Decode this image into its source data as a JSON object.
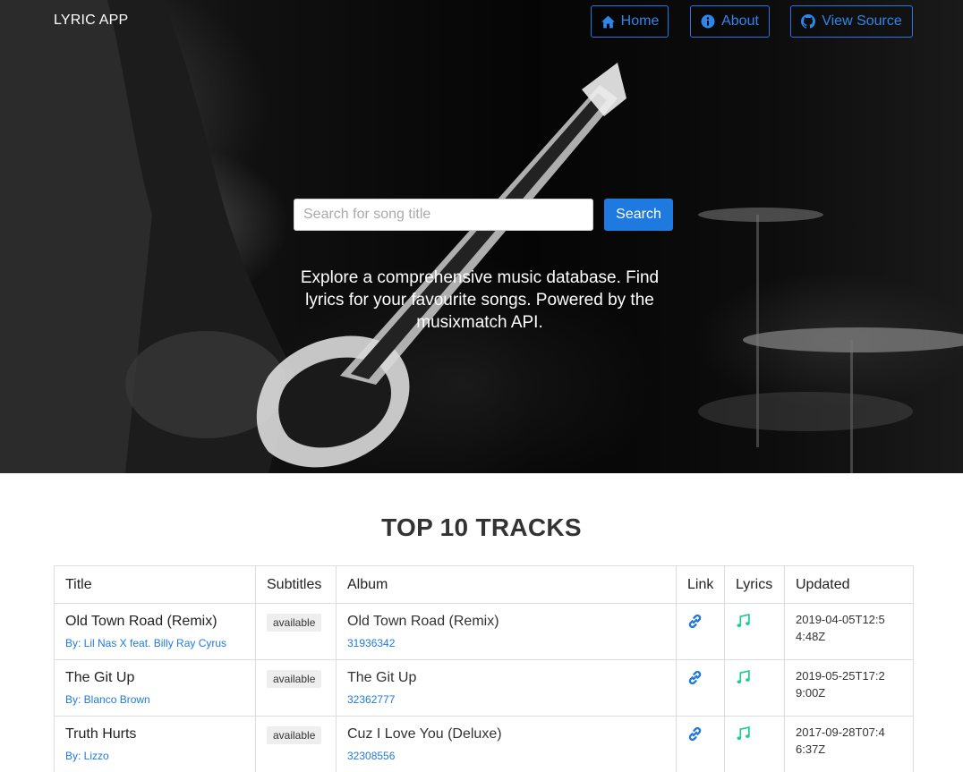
{
  "navbar": {
    "brand": "LYRIC APP",
    "home_label": "Home",
    "about_label": "About",
    "source_label": "View Source",
    "accent_color": "#1f7ae0"
  },
  "hero": {
    "search_placeholder": "Search for song title",
    "search_value": "",
    "search_button_label": "Search",
    "tagline": "Explore a comprehensive music database. Find lyrics for your favourite songs. Powered by the musixmatch API."
  },
  "top_tracks": {
    "title": "TOP 10 TRACKS",
    "columns": [
      "Title",
      "Subtitles",
      "Album",
      "Link",
      "Lyrics",
      "Updated"
    ],
    "rows": [
      {
        "title": "Old Town Road (Remix)",
        "artist": "By: Lil Nas X feat. Billy Ray Cyrus",
        "subtitles": "available",
        "album": "Old Town Road (Remix)",
        "album_id": "31936342",
        "link_icon": "link-icon",
        "lyrics_icon": "music-note-icon",
        "updated": "2019-04-05T12:54:48Z"
      },
      {
        "title": "The Git Up",
        "artist": "By: Blanco Brown",
        "subtitles": "available",
        "album": "The Git Up",
        "album_id": "32362777",
        "link_icon": "link-icon",
        "lyrics_icon": "music-note-icon",
        "updated": "2019-05-25T17:29:00Z"
      },
      {
        "title": "Truth Hurts",
        "artist": "By: Lizzo",
        "subtitles": "available",
        "album": "Cuz I Love You (Deluxe)",
        "album_id": "32308556",
        "link_icon": "link-icon",
        "lyrics_icon": "music-note-icon",
        "updated": "2017-09-28T07:46:37Z"
      }
    ]
  },
  "colors": {
    "link_blue": "#1f7ae0",
    "lyrics_teal": "#20c997"
  }
}
